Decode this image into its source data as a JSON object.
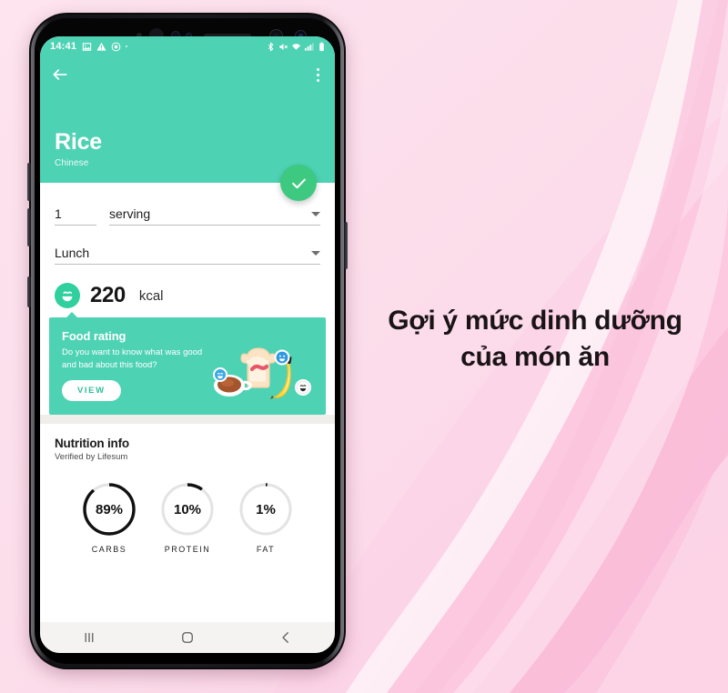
{
  "promo": {
    "headline_line1": "Gợi ý mức dinh dưỡng",
    "headline_line2": "của món ăn",
    "background_color": "#fbd9e8",
    "accent_pink": "#f9b9d6"
  },
  "phone": {
    "status_bar": {
      "time": "14:41",
      "left_icons": [
        "image-icon",
        "warning-triangle-icon",
        "target-icon",
        "dot-icon"
      ],
      "right_icons": [
        "bluetooth-icon",
        "volume-mute-icon",
        "wifi-icon",
        "signal-icon",
        "battery-icon"
      ],
      "background_color": "#4ed2b4"
    },
    "nav_bar": {
      "recent_label": "recent-apps",
      "home_label": "home",
      "back_label": "back"
    }
  },
  "app": {
    "appbar": {
      "back_icon": "arrow-left-icon",
      "overflow_icon": "kebab-menu-icon",
      "background_color": "#4ed2b4"
    },
    "hero": {
      "title": "Rice",
      "subtitle": "Chinese",
      "fab_icon": "check-icon",
      "fab_color": "#3dc97f"
    },
    "form": {
      "amount_value": "1",
      "unit_value": "serving",
      "meal_value": "Lunch",
      "dropdown_icon": "chevron-down-icon"
    },
    "calories": {
      "icon": "smiley-face-icon",
      "value": "220",
      "unit": "kcal"
    },
    "food_rating_card": {
      "title": "Food rating",
      "description": "Do you want to know what was good and bad about this food?",
      "button_label": "VIEW",
      "background_color": "#4ed2b4",
      "art_items": [
        "coffee-cup-icon",
        "toast-with-jam-icon",
        "banana-icon"
      ]
    },
    "nutrition": {
      "title": "Nutrition info",
      "subtitle": "Verified by Lifesum"
    }
  },
  "chart_data": {
    "type": "pie",
    "title": "Nutrition info",
    "categories": [
      "CARBS",
      "PROTEIN",
      "FAT"
    ],
    "values": [
      89,
      10,
      1
    ],
    "value_labels": [
      "89%",
      "10%",
      "1%"
    ],
    "unit": "%",
    "track_color": "#e3e3e3",
    "arc_color": "#111111",
    "start_angle_deg": 0,
    "direction": "clockwise"
  }
}
